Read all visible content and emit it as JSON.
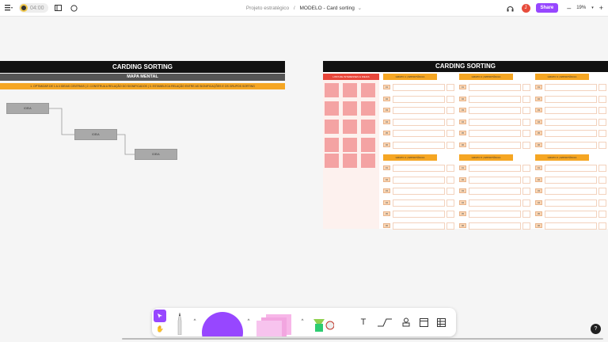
{
  "topbar": {
    "timer": "04:00",
    "breadcrumb_project": "Projeto estratégico",
    "breadcrumb_sep": "/",
    "breadcrumb_file": "MODELO - Card sorting",
    "avatar_initial": "J",
    "share_label": "Share",
    "zoom": "19%"
  },
  "left_frame": {
    "title": "CARDING SORTING",
    "subtitle": "MAPA MENTAL",
    "steps": "1. OPTIMIZAR DE 1 A 4 IDEIAS CENTRAIS   |   2. CONSTRUA A RELAÇÃO DO SIGNIFICADOS   |   3. ESTABELECA RELAÇÃO ENTRE AS SIGNIFICAÇÕES E OS GRUPOS SORTING",
    "nodes": [
      "IDEIA",
      "IDEIA",
      "IDEIA"
    ]
  },
  "right_frame": {
    "title": "CARDING SORTING",
    "ideas_header": "LISTA DE INTERESSES E IDEIAS",
    "groups": [
      "GRUPO 1 | IMPORTÂNCIA",
      "GRUPO 2 | IMPORTÂNCIA",
      "GRUPO 3 | IMPORTÂNCIA",
      "GRUPO 4 | IMPORTÂNCIA",
      "GRUPO 5 | IMPORTÂNCIA",
      "GRUPO 6 | IMPORTÂNCIA"
    ],
    "row_numbers": [
      "01",
      "02",
      "03",
      "04",
      "05",
      "06"
    ]
  },
  "toolbar": {
    "items": [
      "move-tool",
      "hand-tool",
      "pen-tool",
      "shape-tool",
      "sticky-tool",
      "stamp-tool",
      "text-tool",
      "connector-tool",
      "person-tool",
      "section-tool",
      "table-tool"
    ]
  },
  "help_label": "?"
}
